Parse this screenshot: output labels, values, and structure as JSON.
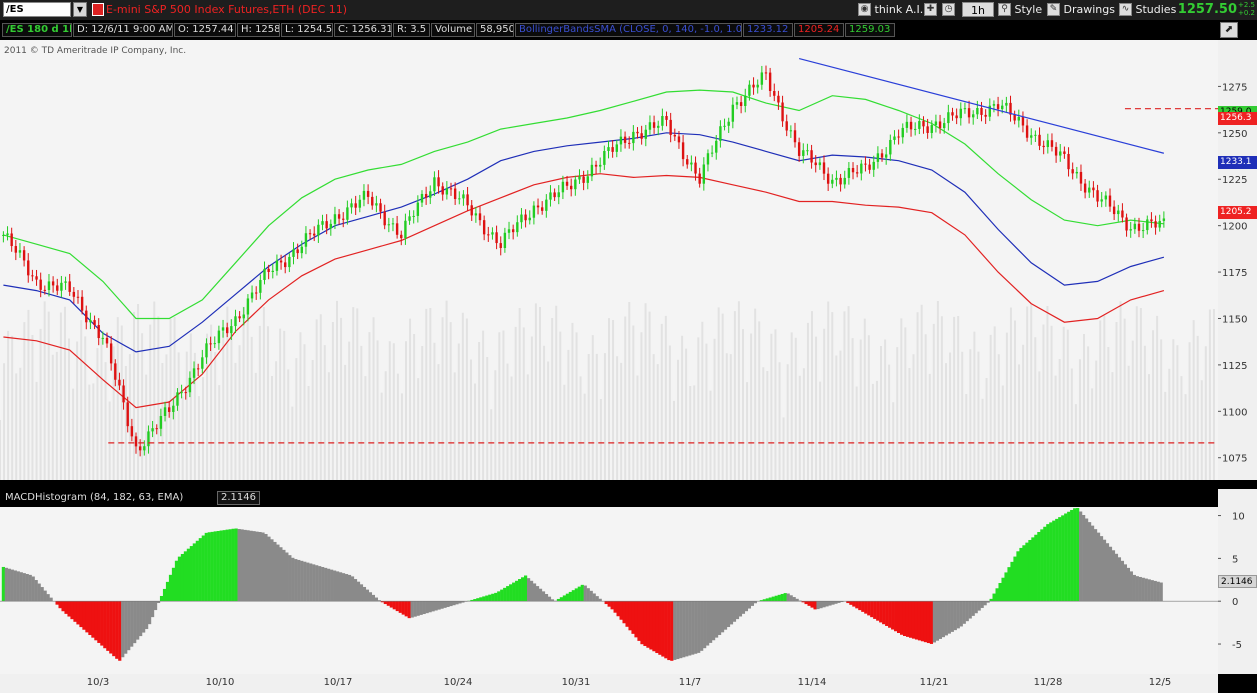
{
  "toolbar": {
    "symbol": "/ES",
    "title": "E-mini S&P 500 Index Futures,ETH (DEC 11)",
    "think_label": "think A.I.",
    "timeframe": "1h",
    "style_label": "Style",
    "drawings_label": "Drawings",
    "studies_label": "Studies",
    "last_price": "1257.50",
    "change_top": "+2.5",
    "change_bottom": "+0.2"
  },
  "quote_bar": {
    "symbol_period": "/ES 180 d 1h",
    "date": "D: 12/6/11 9:00 AM",
    "open": "O: 1257.44",
    "high": "H: 1258",
    "low": "L: 1254.5",
    "close": "C: 1256.31",
    "range": "R: 3.5",
    "volume_label": "Volume",
    "volume_value": "58,950",
    "bb_label": "BollingerBandsSMA (CLOSE, 0, 140, -1.0, 1.0)",
    "bb_mid": "1233.12",
    "bb_lower": "1205.24",
    "bb_upper": "1259.03"
  },
  "copyright": "2011 © TD Ameritrade IP Company, Inc.",
  "macd": {
    "label": "MACDHistogram (84, 182, 63, EMA)",
    "value": "2.1146"
  },
  "axis_tags": {
    "upper": "1259.0",
    "price": "1256.3",
    "mid": "1233.1",
    "lower": "1205.2",
    "macd": "2.1146"
  },
  "chart_data": [
    {
      "type": "candlestick",
      "y_ticks": [
        1075,
        1100,
        1125,
        1150,
        1175,
        1200,
        1225,
        1250,
        1275
      ],
      "ylim": [
        1063,
        1300
      ],
      "x_ticks": [
        "10/3",
        "10/10",
        "10/17",
        "10/24",
        "10/31",
        "11/7",
        "11/14",
        "11/21",
        "11/28",
        "12/5"
      ],
      "x": [
        0,
        2,
        4,
        6,
        8,
        10,
        12,
        14,
        16,
        18,
        20,
        22,
        24,
        26,
        28,
        30,
        32,
        34,
        36,
        38,
        40,
        42,
        44,
        46,
        48,
        50,
        52,
        54,
        56,
        58,
        60,
        62,
        64,
        66,
        68,
        70
      ],
      "close": [
        1195,
        1170,
        1165,
        1140,
        1080,
        1100,
        1130,
        1150,
        1175,
        1190,
        1205,
        1215,
        1195,
        1225,
        1210,
        1190,
        1210,
        1220,
        1235,
        1250,
        1255,
        1225,
        1265,
        1280,
        1240,
        1225,
        1230,
        1250,
        1255,
        1260,
        1265,
        1250,
        1235,
        1215,
        1200,
        1200
      ],
      "series": [
        {
          "name": "BollingerBandsSMA upper",
          "values": [
            1195,
            1190,
            1185,
            1170,
            1150,
            1150,
            1160,
            1180,
            1200,
            1215,
            1225,
            1230,
            1233,
            1240,
            1245,
            1252,
            1255,
            1258,
            1262,
            1267,
            1272,
            1273,
            1272,
            1266,
            1262,
            1270,
            1268,
            1262,
            1255,
            1244,
            1228,
            1214,
            1203,
            1200,
            1203,
            1201
          ]
        },
        {
          "name": "BollingerBandsSMA mid",
          "values": [
            1168,
            1165,
            1160,
            1142,
            1132,
            1135,
            1148,
            1163,
            1178,
            1190,
            1200,
            1205,
            1210,
            1217,
            1225,
            1235,
            1240,
            1243,
            1245,
            1247,
            1250,
            1249,
            1245,
            1240,
            1235,
            1238,
            1237,
            1235,
            1230,
            1218,
            1198,
            1180,
            1168,
            1170,
            1178,
            1183
          ]
        },
        {
          "name": "BollingerBandsSMA lower",
          "values": [
            1140,
            1138,
            1133,
            1117,
            1102,
            1105,
            1120,
            1143,
            1160,
            1173,
            1182,
            1187,
            1192,
            1200,
            1208,
            1215,
            1222,
            1226,
            1228,
            1226,
            1227,
            1226,
            1222,
            1218,
            1213,
            1213,
            1211,
            1210,
            1207,
            1195,
            1175,
            1158,
            1148,
            1150,
            1160,
            1165
          ]
        }
      ],
      "annotations": {
        "trendline": [
          [
            48,
            1290
          ],
          [
            70,
            1239
          ]
        ],
        "support_level": 1083,
        "resistance_level": 1263
      }
    },
    {
      "type": "bar",
      "title": "MACDHistogram (84, 182, 63, EMA)",
      "y_ticks": [
        -5,
        0,
        5,
        10
      ],
      "ylim": [
        -8.5,
        11
      ],
      "x": [
        0,
        2,
        4,
        6,
        8,
        10,
        12,
        14,
        16,
        18,
        20,
        22,
        24,
        26,
        28,
        30,
        32,
        34,
        36,
        38,
        40,
        42,
        44,
        46,
        48,
        50,
        52,
        54,
        56,
        58,
        60,
        62,
        64,
        66,
        68,
        70
      ],
      "values": [
        4,
        3,
        -1,
        -4,
        -7,
        -3,
        5,
        8,
        8.5,
        8,
        5,
        4,
        3,
        0,
        -2,
        -1,
        0,
        1,
        3,
        0,
        2,
        -1,
        -5,
        -7,
        -6,
        -3,
        0,
        1,
        -1,
        0,
        -2,
        -4,
        -5,
        -3,
        0,
        6,
        9,
        11,
        7,
        3,
        2.1
      ]
    }
  ]
}
